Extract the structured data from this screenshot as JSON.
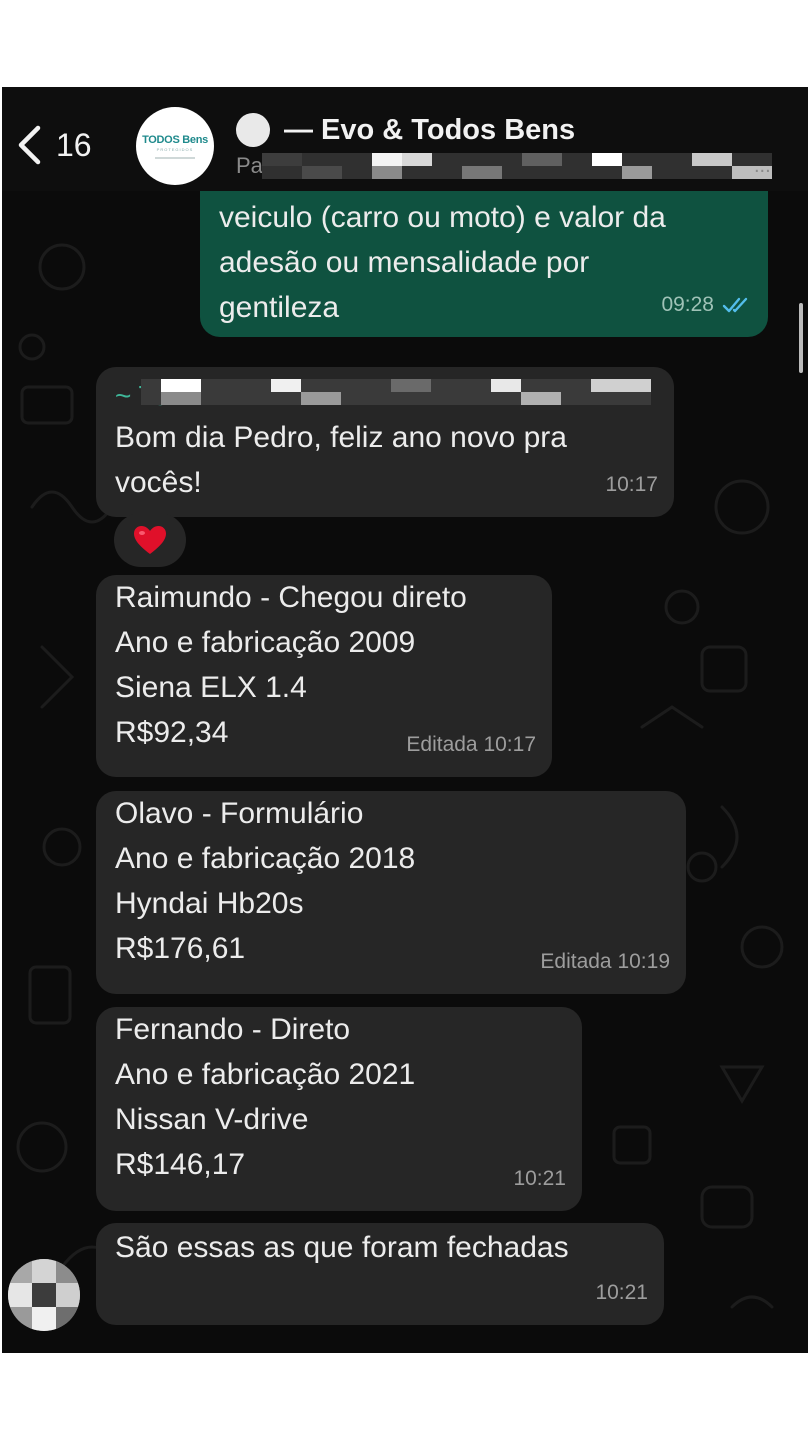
{
  "header": {
    "back_count": "16",
    "group_avatar": {
      "logo_main": "TODOS Bens",
      "logo_sub": "PROTEGIDOS"
    },
    "title": "— Evo & Todos Bens",
    "subtitle_visible": "Pau",
    "subtitle_ellipsis": "..."
  },
  "messages": [
    {
      "direction": "outgoing",
      "text": "veiculo (carro ou moto) e valor da\nadesão ou mensalidade por\ngentileza",
      "time": "09:28",
      "read_receipt": "double-check-icon"
    },
    {
      "direction": "incoming",
      "sender_prefix": "~ To",
      "text": "Bom dia Pedro, feliz ano novo pra\nvocês!",
      "time": "10:17",
      "reaction": "❤️"
    },
    {
      "direction": "incoming",
      "text": "Raimundo - Chegou direto\nAno e fabricação 2009\nSiena ELX 1.4\nR$92,34",
      "time": "Editada 10:17"
    },
    {
      "direction": "incoming",
      "text": "Olavo - Formulário\nAno e fabricação 2018\nHyndai Hb20s\nR$176,61",
      "time": "Editada 10:19"
    },
    {
      "direction": "incoming",
      "text": "Fernando - Direto\nAno e fabricação 2021\nNissan V-drive\nR$146,17",
      "time": "10:21"
    },
    {
      "direction": "incoming",
      "text": "São essas as que foram fechadas",
      "time": "10:21"
    }
  ],
  "colors": {
    "background": "#0b0b0b",
    "incoming_bubble": "#262626",
    "outgoing_bubble": "#0f5240",
    "sender_name": "#3fb89a",
    "read_tick": "#53bdeb"
  }
}
